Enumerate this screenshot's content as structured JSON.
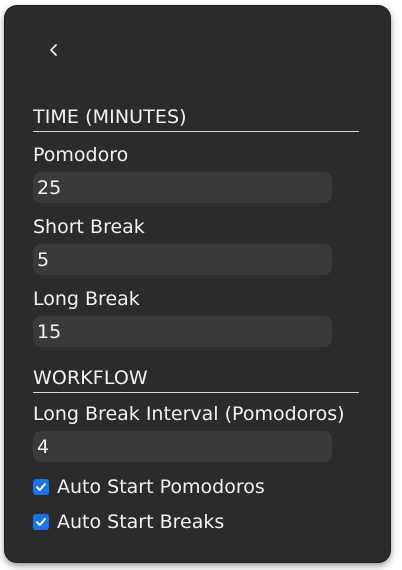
{
  "sections": {
    "time_title": "TIME (MINUTES)",
    "workflow_title": "WORKFLOW"
  },
  "fields": {
    "pomodoro": {
      "label": "Pomodoro",
      "value": "25"
    },
    "short_break": {
      "label": "Short Break",
      "value": "5"
    },
    "long_break": {
      "label": "Long Break",
      "value": "15"
    },
    "long_break_interval": {
      "label": "Long Break Interval (Pomodoros)",
      "value": "4"
    }
  },
  "toggles": {
    "auto_start_pomodoros": {
      "label": "Auto Start Pomodoros",
      "checked": true
    },
    "auto_start_breaks": {
      "label": "Auto Start Breaks",
      "checked": true
    }
  },
  "icons": {
    "back": "chevron-left-icon",
    "check": "checkmark-icon"
  },
  "colors": {
    "panel_background": "#2b2b2b",
    "input_background": "#3a3a3a",
    "text": "#f2f2f2",
    "checkbox_accent": "#1a73e8"
  }
}
